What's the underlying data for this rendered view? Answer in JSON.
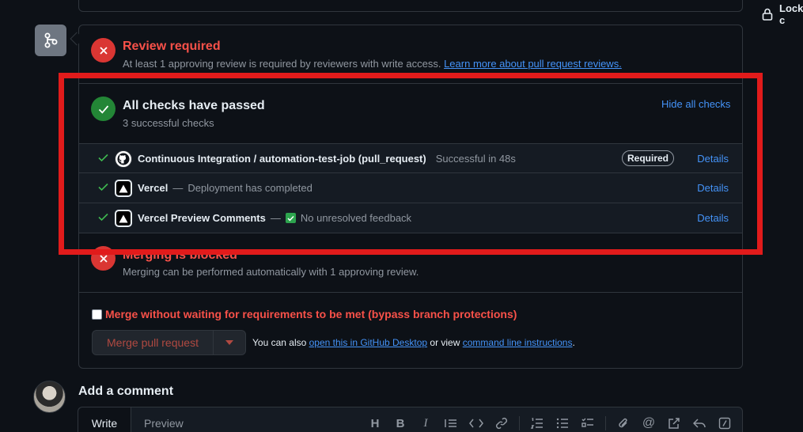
{
  "header": {
    "lock_label": "Lock c"
  },
  "review": {
    "title": "Review required",
    "description": "At least 1 approving review is required by reviewers with write access.",
    "link": "Learn more about pull request reviews."
  },
  "checks": {
    "title": "All checks have passed",
    "subtitle": "3 successful checks",
    "toggle": "Hide all checks",
    "items": [
      {
        "name": "Continuous Integration / automation-test-job (pull_request)",
        "status": "Successful in 48s",
        "badge": "Required",
        "details": "Details"
      },
      {
        "name": "Vercel",
        "separator": "—",
        "status": "Deployment has completed",
        "details": "Details"
      },
      {
        "name": "Vercel Preview Comments",
        "separator": "—",
        "status": "No unresolved feedback",
        "details": "Details"
      }
    ]
  },
  "blocked": {
    "title": "Merging is blocked",
    "description": "Merging can be performed automatically with 1 approving review."
  },
  "bypass": {
    "label": "Merge without waiting for requirements to be met (bypass branch protections)",
    "checked": false
  },
  "merge": {
    "button": "Merge pull request",
    "also_prefix": "You can also",
    "desktop_link": "open this in GitHub Desktop",
    "or_view": "or view",
    "cli_link": "command line instructions",
    "suffix": "."
  },
  "comment": {
    "heading": "Add a comment",
    "tab_write": "Write",
    "tab_preview": "Preview",
    "toolbar": [
      "heading-icon",
      "bold-icon",
      "italic-icon",
      "quote-icon",
      "code-icon",
      "link-icon",
      "ordered-list-icon",
      "unordered-list-icon",
      "task-list-icon",
      "attach-icon",
      "mention-icon",
      "cross-reference-icon",
      "reply-icon",
      "slash-command-icon"
    ]
  },
  "colors": {
    "error": "#da3633",
    "success": "#238636",
    "link": "#4493f8",
    "annotation": "#e11b1b"
  }
}
